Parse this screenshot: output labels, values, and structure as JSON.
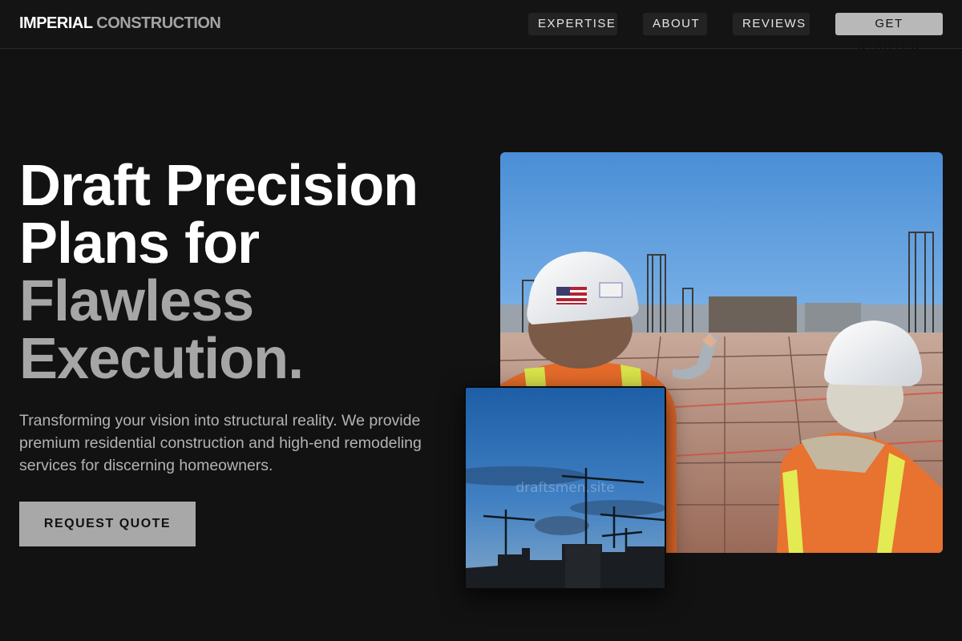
{
  "header": {
    "logo_primary": "IMPERIAL",
    "logo_secondary": "CONSTRUCTION",
    "nav": [
      "EXPERTISE",
      "ABOUT",
      "REVIEWS"
    ],
    "cta": "GET STARTED"
  },
  "hero": {
    "headline": [
      "Draft Precision",
      "Plans for",
      "Flawless",
      "Execution."
    ],
    "subtext": "Transforming your vision into structural reality. We provide premium residential construction and high-end remodeling services for discerning homeowners.",
    "button": "REQUEST QUOTE"
  },
  "images": {
    "secondary_watermark": "draftsmen.site"
  },
  "colors": {
    "background": "#121212",
    "accent_gray": "#a8a8a8",
    "muted_text": "#a6a6a6"
  }
}
